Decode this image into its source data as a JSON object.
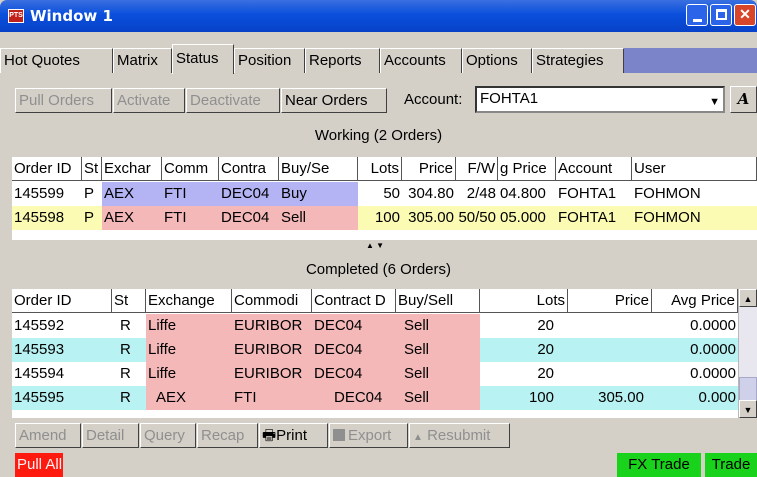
{
  "window": {
    "title": "Window 1",
    "app_icon_text": "PTS"
  },
  "tabs": [
    "Hot Quotes",
    "Matrix",
    "Status",
    "Position",
    "Reports",
    "Accounts",
    "Options",
    "Strategies"
  ],
  "active_tab": "Status",
  "toolbar": {
    "pull_orders": "Pull Orders",
    "activate": "Activate",
    "deactivate": "Deactivate",
    "near_orders": "Near Orders",
    "account_label": "Account:",
    "account_value": "FOHTA1",
    "italic_button": "A"
  },
  "working": {
    "title": "Working (2 Orders)",
    "headers": [
      "Order ID",
      "St",
      "Exchar",
      "Comm",
      "Contra",
      "Buy/Se",
      "Lots",
      "Price",
      "F/W",
      "g Price",
      "Account",
      "User"
    ],
    "rows": [
      [
        "145599",
        "P",
        "AEX",
        "FTI",
        "DEC04",
        "Buy",
        "50",
        "304.80",
        "2/48",
        "04.800",
        "FOHTA1",
        "FOHMON"
      ],
      [
        "145598",
        "P",
        "AEX",
        "FTI",
        "DEC04",
        "Sell",
        "100",
        "305.00",
        "50/50",
        "05.000",
        "FOHTA1",
        "FOHMON"
      ]
    ]
  },
  "completed": {
    "title": "Completed (6 Orders)",
    "headers": [
      "Order ID",
      "St",
      "Exchange",
      "Commodi",
      "Contract D",
      "Buy/Sell",
      "Lots",
      "Price",
      "Avg Price"
    ],
    "rows": [
      [
        "145592",
        "R",
        "Liffe",
        "EURIBOR",
        "DEC04",
        "Sell",
        "20",
        "",
        "0.0000"
      ],
      [
        "145593",
        "R",
        "Liffe",
        "EURIBOR",
        "DEC04",
        "Sell",
        "20",
        "",
        "0.0000"
      ],
      [
        "145594",
        "R",
        "Liffe",
        "EURIBOR",
        "DEC04",
        "Sell",
        "20",
        "",
        "0.0000"
      ],
      [
        "145595",
        "R",
        "AEX",
        "FTI",
        "DEC04",
        "Sell",
        "100",
        "305.00",
        "0.000"
      ]
    ]
  },
  "bottom_toolbar": {
    "amend": "Amend",
    "detail": "Detail",
    "query": "Query",
    "recap": "Recap",
    "print": "Print",
    "export": "Export",
    "resubmit": "Resubmit"
  },
  "status_bar": {
    "pull_all": "Pull All",
    "fx_trade": "FX Trade",
    "trade": "Trade"
  },
  "colors": {
    "title_bar": "#0a4fdc",
    "tab_filler": "#7b83c9",
    "exchange_cell": "#b4b4f4",
    "buy_cell": "#b4b4f4",
    "sell_cell": "#f4b8b8",
    "sell_row_bg": "#fbfbb4",
    "completed_alt_row": "#b9f2f2",
    "pull_all": "#ff1a0f",
    "trade": "#18d21c"
  }
}
